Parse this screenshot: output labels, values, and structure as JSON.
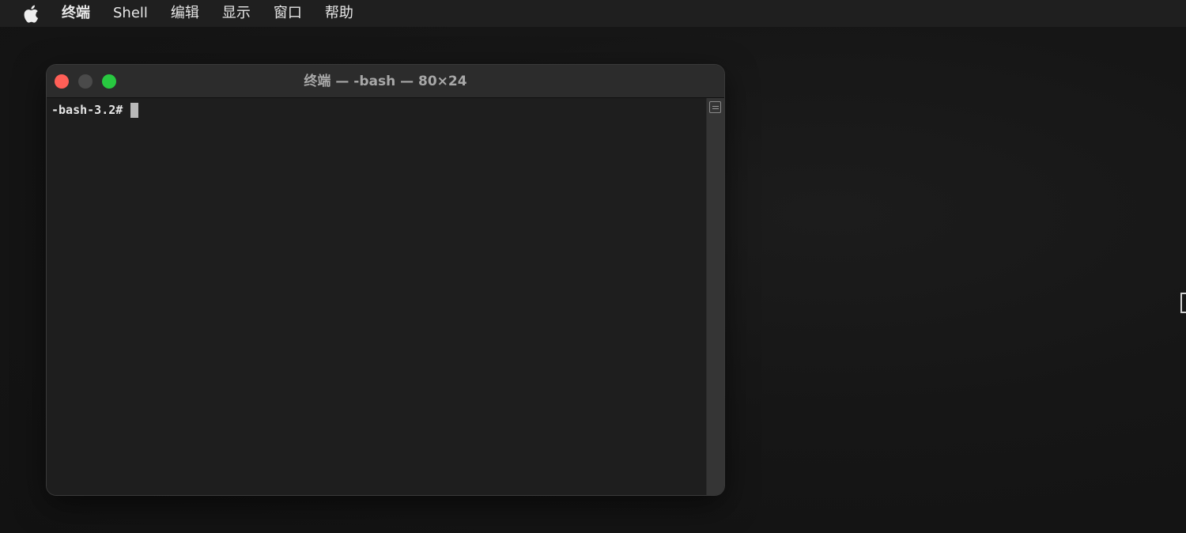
{
  "menubar": {
    "apple_icon": "apple-icon",
    "items": [
      {
        "label": "终端"
      },
      {
        "label": "Shell"
      },
      {
        "label": "编辑"
      },
      {
        "label": "显示"
      },
      {
        "label": "窗口"
      },
      {
        "label": "帮助"
      }
    ]
  },
  "window": {
    "title": "终端 — -bash — 80×24",
    "controls": {
      "close": "#ff5f57",
      "minimize": "#4a4a4a",
      "zoom": "#28c840"
    },
    "prompt": "-bash-3.2#"
  }
}
